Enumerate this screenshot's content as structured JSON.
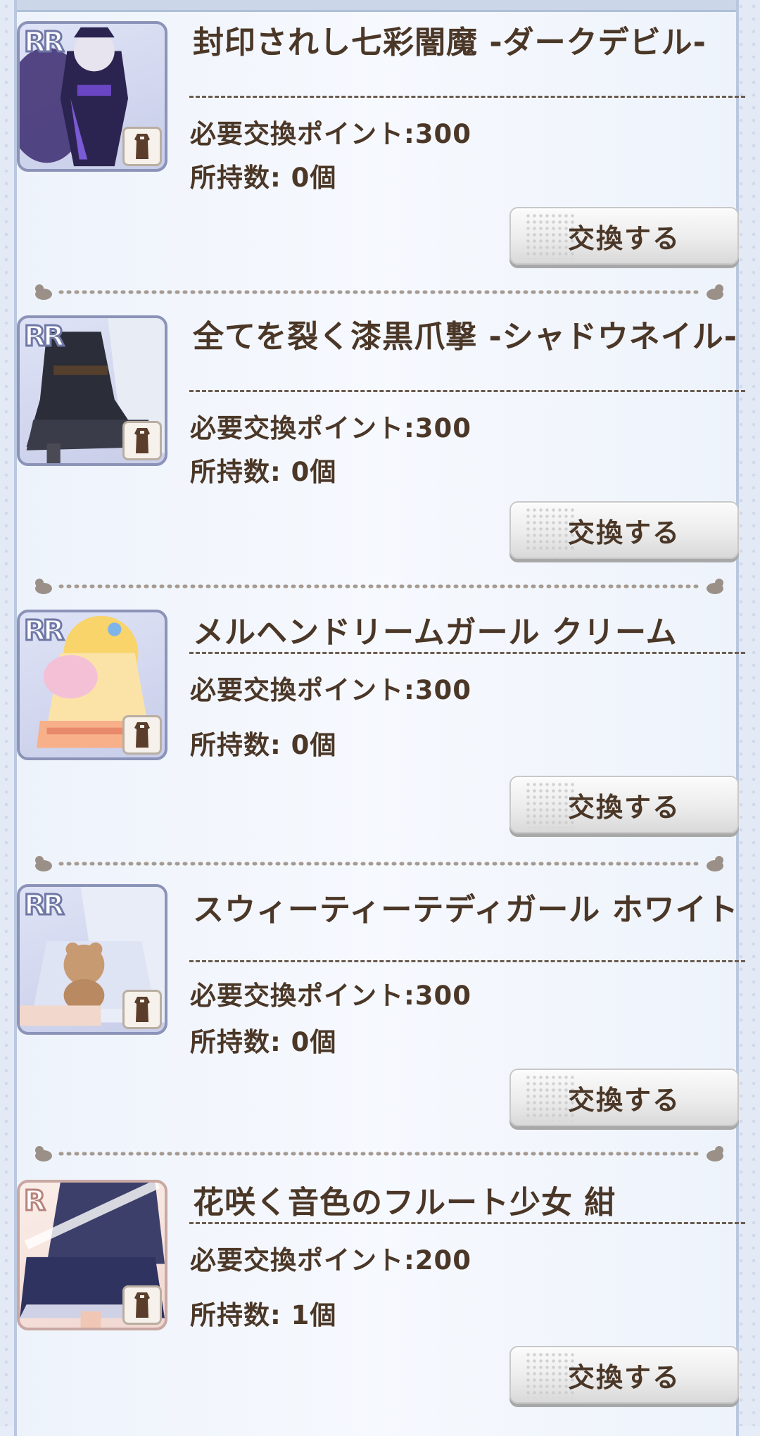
{
  "items": [
    {
      "title": "封印されし七彩闇魔 -ダークデビル-",
      "points": "必要交換ポイント:300",
      "owned": "所持数: 0個",
      "button": "交換する",
      "rarity": "RR"
    },
    {
      "title": "全てを裂く漆黒爪撃 -シャドウネイル-",
      "points": "必要交換ポイント:300",
      "owned": "所持数: 0個",
      "button": "交換する",
      "rarity": "RR"
    },
    {
      "title": "メルヘンドリームガール クリーム",
      "points": "必要交換ポイント:300",
      "owned": "所持数: 0個",
      "button": "交換する",
      "rarity": "RR"
    },
    {
      "title": "スウィーティーテディガール ホワイト",
      "points": "必要交換ポイント:300",
      "owned": "所持数: 0個",
      "button": "交換する",
      "rarity": "RR"
    },
    {
      "title": "花咲く音色のフルート少女 紺",
      "points": "必要交換ポイント:200",
      "owned": "所持数: 1個",
      "button": "交換する",
      "rarity": "R"
    }
  ],
  "colors": {
    "text": "#4b3727",
    "panel": "#f3f7fd",
    "button": "#e8e8e8"
  },
  "icons": [
    "dress-icon",
    "duck-icon"
  ]
}
